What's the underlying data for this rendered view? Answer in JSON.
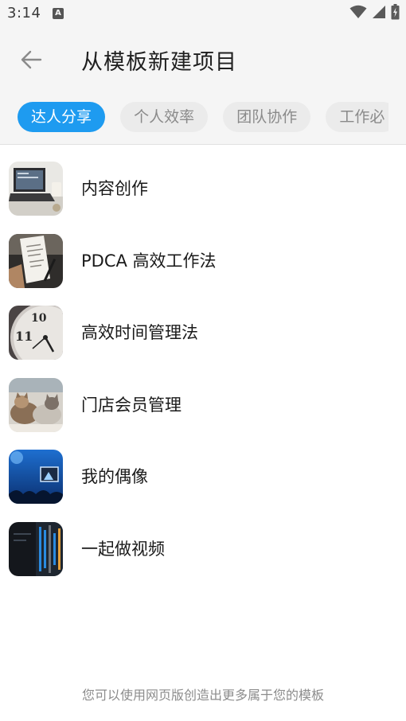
{
  "status_bar": {
    "time": "3:14",
    "a_icon_letter": "A",
    "icons": [
      "notification-a-icon",
      "wifi-icon",
      "signal-icon",
      "battery-charging-icon"
    ]
  },
  "app_bar": {
    "back_icon": "arrow-left-icon",
    "title": "从模板新建项目"
  },
  "tabs": [
    {
      "label": "达人分享",
      "active": true
    },
    {
      "label": "个人效率",
      "active": false
    },
    {
      "label": "团队协作",
      "active": false
    },
    {
      "label": "工作必",
      "active": false
    }
  ],
  "templates": [
    {
      "label": "内容创作",
      "thumb": "laptop-desk-photo"
    },
    {
      "label": "PDCA 高效工作法",
      "thumb": "receipt-notes-photo"
    },
    {
      "label": "高效时间管理法",
      "thumb": "clock-face-photo"
    },
    {
      "label": "门店会员管理",
      "thumb": "cats-photo"
    },
    {
      "label": "我的偶像",
      "thumb": "concert-stage-photo"
    },
    {
      "label": "一起做视频",
      "thumb": "video-editing-photo"
    }
  ],
  "footer": {
    "note": "您可以使用网页版创造出更多属于您的模板"
  },
  "colors": {
    "accent": "#1e9bf0",
    "header_bg": "#f5f5f5",
    "tab_inactive_bg": "#ebebeb"
  }
}
